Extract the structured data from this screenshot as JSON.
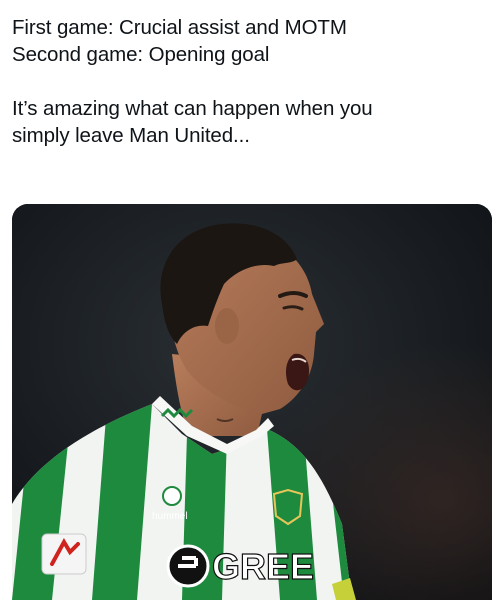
{
  "post": {
    "lines": [
      "First game: Crucial assist and MOTM",
      "Second game: Opening goal",
      "It’s amazing what can happen when you",
      "simply leave Man United..."
    ]
  },
  "media": {
    "sponsor": "GREE",
    "kit_brand": "hummel",
    "colors": {
      "kit_green": "#1e8a3e",
      "kit_white": "#f2f4f2",
      "background": "#14181c",
      "skin": "#a8704f",
      "hair": "#1b1612"
    }
  }
}
